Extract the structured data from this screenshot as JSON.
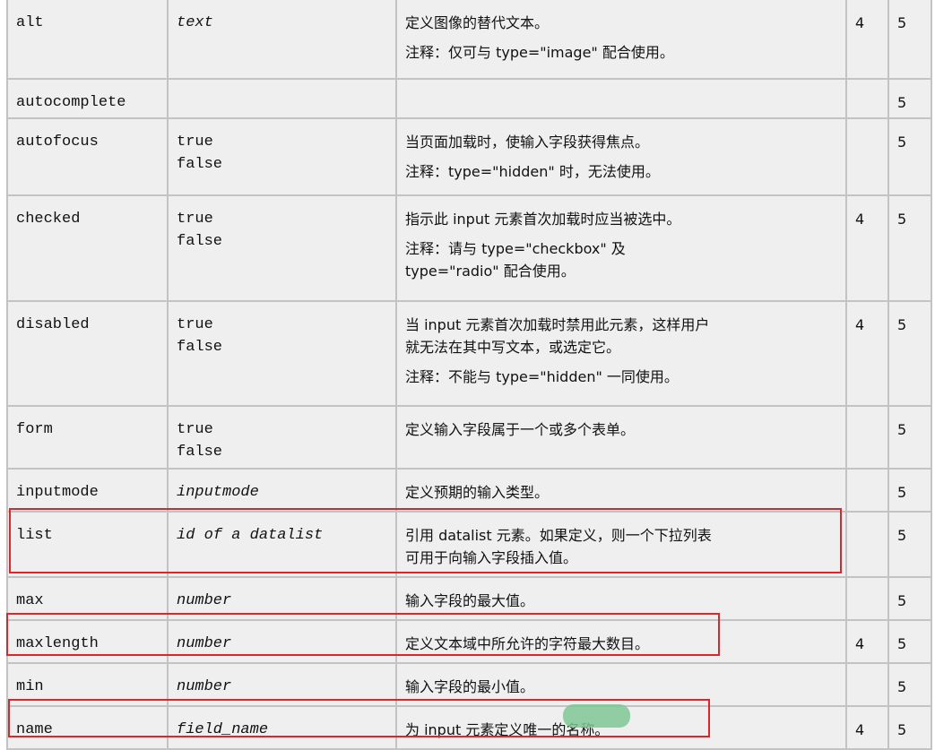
{
  "rows": [
    {
      "attr": "alt",
      "value": "text",
      "value_italic": true,
      "desc": [
        "定义图像的替代文本。",
        "注释：仅可与 type=\"image\" 配合使用。"
      ],
      "v4": "4",
      "v5": "5"
    },
    {
      "attr": "autocomplete",
      "value": "",
      "value_italic": false,
      "desc": [],
      "v4": "",
      "v5": "5"
    },
    {
      "attr": "autofocus",
      "value": "true\nfalse",
      "value_italic": false,
      "desc": [
        "当页面加载时，使输入字段获得焦点。",
        "注释：type=\"hidden\" 时，无法使用。"
      ],
      "v4": "",
      "v5": "5"
    },
    {
      "attr": "checked",
      "value": "true\nfalse",
      "value_italic": false,
      "desc": [
        "指示此 input 元素首次加载时应当被选中。",
        "注释：请与 type=\"checkbox\" 及\ntype=\"radio\" 配合使用。"
      ],
      "v4": "4",
      "v5": "5"
    },
    {
      "attr": "disabled",
      "value": "true\nfalse",
      "value_italic": false,
      "desc": [
        "当 input 元素首次加载时禁用此元素，这样用户\n就无法在其中写文本，或选定它。",
        "注释：不能与 type=\"hidden\" 一同使用。"
      ],
      "v4": "4",
      "v5": "5"
    },
    {
      "attr": "form",
      "value": "true\nfalse",
      "value_italic": false,
      "desc": [
        "定义输入字段属于一个或多个表单。"
      ],
      "v4": "",
      "v5": "5"
    },
    {
      "attr": "inputmode",
      "value": "inputmode",
      "value_italic": true,
      "desc": [
        "定义预期的输入类型。"
      ],
      "v4": "",
      "v5": "5"
    },
    {
      "attr": "list",
      "value": "id of a datalist",
      "value_italic": true,
      "desc": [
        "引用 datalist 元素。如果定义，则一个下拉列表\n可用于向输入字段插入值。"
      ],
      "v4": "",
      "v5": "5"
    },
    {
      "attr": "max",
      "value": "number",
      "value_italic": true,
      "desc": [
        "输入字段的最大值。"
      ],
      "v4": "",
      "v5": "5"
    },
    {
      "attr": "maxlength",
      "value": "number",
      "value_italic": true,
      "desc": [
        "定义文本域中所允许的字符最大数目。"
      ],
      "v4": "4",
      "v5": "5"
    },
    {
      "attr": "min",
      "value": "number",
      "value_italic": true,
      "desc": [
        "输入字段的最小值。"
      ],
      "v4": "",
      "v5": "5"
    },
    {
      "attr": "name",
      "value": "field_name",
      "value_italic": true,
      "desc": [
        "为 input 元素定义唯一的名称。"
      ],
      "v4": "4",
      "v5": "5"
    }
  ],
  "annotations": {
    "box_color": "#e0242c",
    "highlight_color": "#7fc795"
  }
}
